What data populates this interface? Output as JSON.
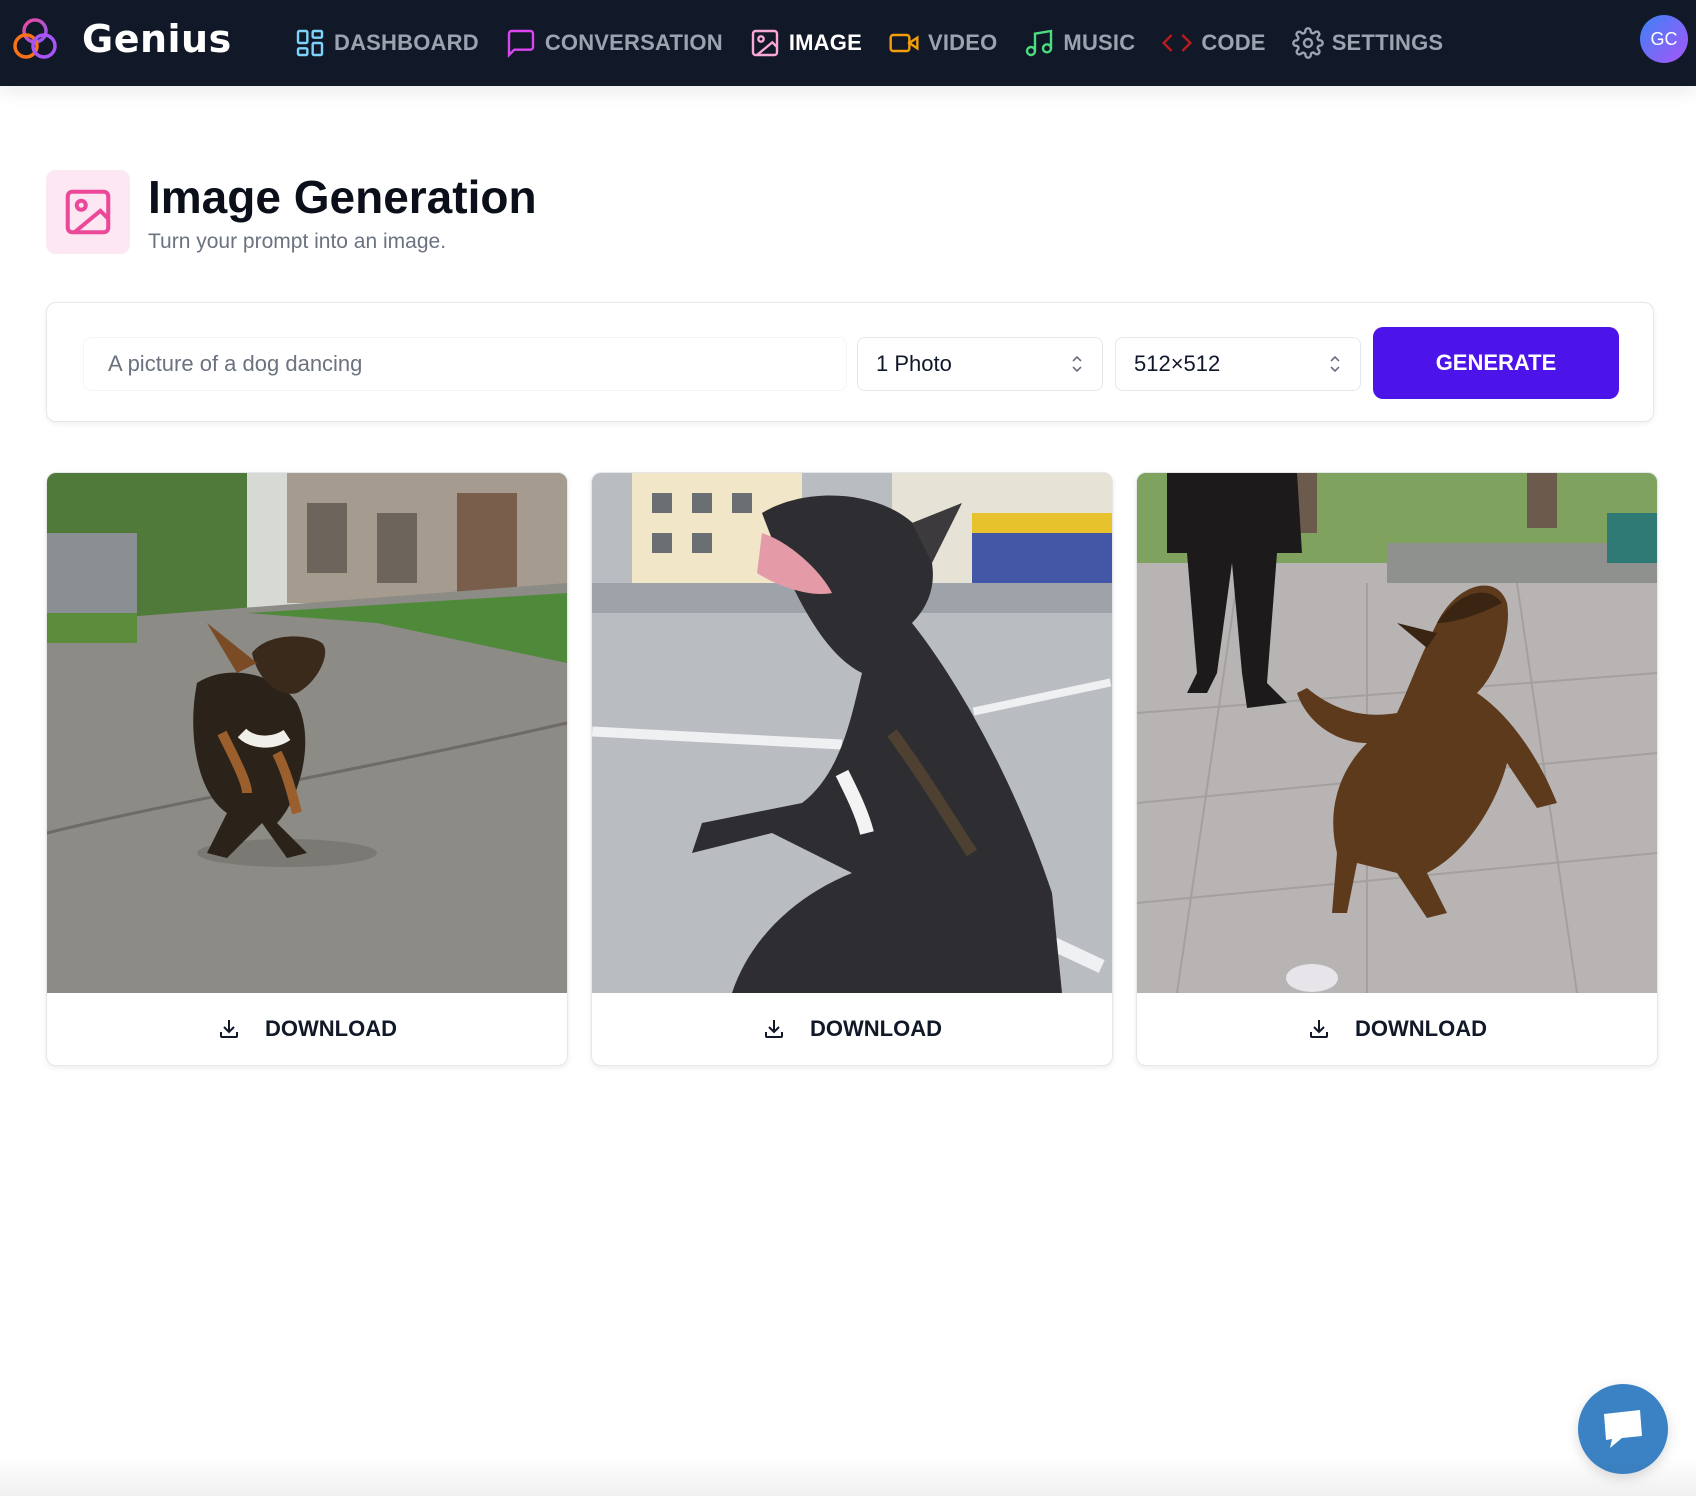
{
  "app": {
    "name": "Genius"
  },
  "nav": {
    "items": [
      {
        "label": "DASHBOARD",
        "icon": "layout-grid-icon",
        "color": "#7dd3fc",
        "active": false
      },
      {
        "label": "CONVERSATION",
        "icon": "message-square-icon",
        "color": "#d946ef",
        "active": false
      },
      {
        "label": "IMAGE",
        "icon": "image-icon",
        "color": "#f9a8d4",
        "active": true
      },
      {
        "label": "VIDEO",
        "icon": "video-icon",
        "color": "#f59e0b",
        "active": false
      },
      {
        "label": "MUSIC",
        "icon": "music-icon",
        "color": "#4ade80",
        "active": false
      },
      {
        "label": "CODE",
        "icon": "code-icon",
        "color": "#b91c1c",
        "active": false
      },
      {
        "label": "SETTINGS",
        "icon": "gear-icon",
        "color": "#9ca3af",
        "active": false
      }
    ]
  },
  "user": {
    "initials": "GC"
  },
  "header": {
    "title": "Image Generation",
    "subtitle": "Turn your prompt into an image.",
    "icon": "image-icon",
    "icon_color": "#ec4899"
  },
  "form": {
    "prompt_placeholder": "A picture of a dog dancing",
    "amount": "1 Photo",
    "resolution": "512×512",
    "generate_label": "GENERATE"
  },
  "images": [
    {
      "download_label": "DOWNLOAD"
    },
    {
      "download_label": "DOWNLOAD"
    },
    {
      "download_label": "DOWNLOAD"
    }
  ],
  "colors": {
    "accent": "#4c14e8",
    "topbar": "#111827",
    "chat": "#3b82c4"
  }
}
